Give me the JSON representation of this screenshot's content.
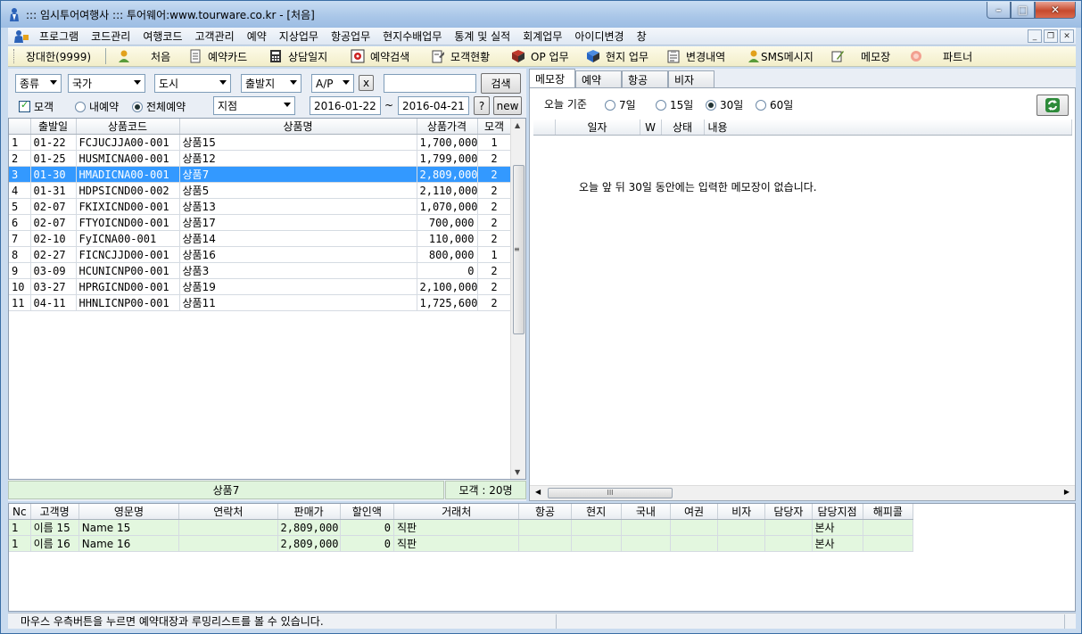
{
  "window": {
    "title": "::: 임시투어여행사 ::: 투어웨어:www.tourware.co.kr - [처음]",
    "btn_min": "–",
    "btn_max": "□",
    "btn_close": "✕"
  },
  "menu": {
    "items": [
      "프로그램",
      "코드관리",
      "여행코드",
      "고객관리",
      "예약",
      "지상업무",
      "항공업무",
      "현지수배업무",
      "통계 및 실적",
      "회계업무",
      "아이디변경",
      "창"
    ],
    "mdi_min": "_",
    "mdi_restore": "❐",
    "mdi_close": "✕"
  },
  "toolbar": {
    "user": "장대한(9999)",
    "items": [
      {
        "label": "처음",
        "icon": "person-icon",
        "color": "#e2a11c"
      },
      {
        "label": "예약카드",
        "icon": "document-icon",
        "color": "#555555"
      },
      {
        "label": "상담일지",
        "icon": "calculator-icon",
        "color": "#333333"
      },
      {
        "label": "예약검색",
        "icon": "record-icon",
        "color": "#cc2222"
      },
      {
        "label": "모객현황",
        "icon": "notepad-icon",
        "color": "#444444"
      },
      {
        "label": "OP 업무",
        "icon": "book-icon",
        "color": "#c0392b"
      },
      {
        "label": "현지 업무",
        "icon": "book-blue-icon",
        "color": "#2766c4"
      },
      {
        "label": "변경내역",
        "icon": "clipboard-icon",
        "color": "#444444"
      },
      {
        "label": "SMS메시지",
        "icon": "people-icon",
        "color": "#e2a11c"
      },
      {
        "label": "메모장",
        "icon": "pencil-icon",
        "color": "#5b8c2a"
      },
      {
        "label": "파트너",
        "icon": "partner-icon",
        "color": "#f2a090"
      }
    ]
  },
  "filters": {
    "kind": "종류",
    "country": "국가",
    "city": "도시",
    "departure": "출발지",
    "ap": "A/P",
    "clear": "x",
    "search_value": "",
    "search_btn": "검색",
    "chk_moaek": "모객",
    "radio_my": "내예약",
    "radio_all": "전체예약",
    "branch": "지점",
    "date_from": "2016-01-22",
    "tilde": "~",
    "date_to": "2016-04-21",
    "help": "?",
    "new": "new"
  },
  "product_table": {
    "headers": [
      "",
      "출발일",
      "상품코드",
      "상품명",
      "상품가격",
      "모객"
    ],
    "rows": [
      [
        "1",
        "01-22",
        "FCJUCJJA00-001",
        "상품15",
        "1,700,000",
        "1"
      ],
      [
        "2",
        "01-25",
        "HUSMICNA00-001",
        "상품12",
        "1,799,000",
        "2"
      ],
      [
        "3",
        "01-30",
        "HMADICNA00-001",
        "상품7",
        "2,809,000",
        "2"
      ],
      [
        "4",
        "01-31",
        "HDPSICND00-002",
        "상품5",
        "2,110,000",
        "2"
      ],
      [
        "5",
        "02-07",
        "FKIXICND00-001",
        "상품13",
        "1,070,000",
        "2"
      ],
      [
        "6",
        "02-07",
        "FTYOICND00-001",
        "상품17",
        "700,000",
        "2"
      ],
      [
        "7",
        "02-10",
        "FyICNA00-001",
        "상품14",
        "110,000",
        "2"
      ],
      [
        "8",
        "02-27",
        "FICNCJJD00-001",
        "상품16",
        "800,000",
        "1"
      ],
      [
        "9",
        "03-09",
        "HCUNICNP00-001",
        "상품3",
        "0",
        "2"
      ],
      [
        "10",
        "03-27",
        "HPRGICND00-001",
        "상품19",
        "2,100,000",
        "2"
      ],
      [
        "11",
        "04-11",
        "HHNLICNP00-001",
        "상품11",
        "1,725,600",
        "2"
      ]
    ],
    "selected_index": 2,
    "footer_name": "상품7",
    "footer_count": "모객 : 20명"
  },
  "right_panel": {
    "tabs": [
      "메모장",
      "예약",
      "항공",
      "비자"
    ],
    "period_label": "오늘 기준",
    "periods": [
      "7일",
      "15일",
      "30일",
      "60일"
    ],
    "selected_period": 2,
    "memo_headers": [
      "",
      "일자",
      "W",
      "상태",
      "내용"
    ],
    "empty_message": "오늘 앞 뒤 30일 동안에는 입력한 메모장이 없습니다.",
    "scroll_thumb_mark": "III"
  },
  "customer_table": {
    "headers": [
      "Nc",
      "고객명",
      "영문명",
      "연락처",
      "판매가",
      "할인액",
      "거래처",
      "항공",
      "현지",
      "국내",
      "여권",
      "비자",
      "담당자",
      "담당지점",
      "해피콜"
    ],
    "rows": [
      [
        "1",
        "이름 15",
        "Name 15",
        "",
        "2,809,000",
        "0",
        "직판",
        "",
        "",
        "",
        "",
        "",
        "",
        "본사",
        ""
      ],
      [
        "1",
        "이름 16",
        "Name 16",
        "",
        "2,809,000",
        "0",
        "직판",
        "",
        "",
        "",
        "",
        "",
        "",
        "본사",
        ""
      ]
    ]
  },
  "status": {
    "message": "마우스 우측버튼을 누르면 예약대장과 루밍리스트를 볼 수 있습니다."
  }
}
